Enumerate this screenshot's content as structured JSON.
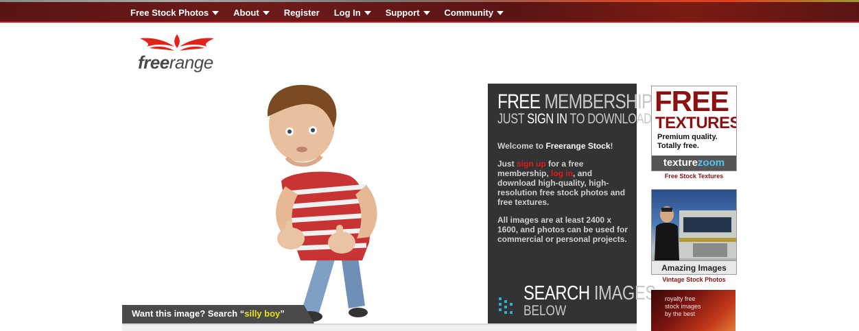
{
  "nav": {
    "items": [
      {
        "label": "Free Stock Photos",
        "dropdown": true
      },
      {
        "label": "About",
        "dropdown": true
      },
      {
        "label": "Register",
        "dropdown": false
      },
      {
        "label": "Log In",
        "dropdown": true
      },
      {
        "label": "Support",
        "dropdown": true
      },
      {
        "label": "Community",
        "dropdown": true
      }
    ]
  },
  "logo": {
    "free": "free",
    "range": "range"
  },
  "hero": {
    "caption_prefix": "Want this image?  Search “",
    "caption_term": "silly boy",
    "caption_suffix": "”"
  },
  "member": {
    "title_a": "FREE",
    "title_b": "MEMBERSHIP",
    "sub_a": "JUST",
    "sub_b": "SIGN IN",
    "sub_c": "TO DOWNLOAD",
    "welcome_prefix": "Welcome to ",
    "welcome_brand": "Freerange Stock",
    "welcome_suffix": "!",
    "just": "Just ",
    "signup": "sign up",
    "mid": " for a free membership, ",
    "login": "log in",
    "rest": ", and download high-quality, high-resolution free stock photos and free textures.",
    "images_note": "All images are at least 2400 x 1600, and photos can be used for commercial or personal projects.",
    "search_a": "SEARCH",
    "search_b": "IMAGES",
    "search_c": "BELOW"
  },
  "ads": {
    "textures": {
      "free": "FREE",
      "textures": "TEXTURES",
      "line1": "Premium quality.",
      "line2": "Totally free.",
      "brand_a": "texture",
      "brand_b": "zoom",
      "caption": "Free Stock Textures"
    },
    "vintage": {
      "label": "Amazing Images",
      "caption": "Vintage Stock Photos"
    },
    "royalty": {
      "line1": "royalty free",
      "line2": "stock images",
      "line3": "by the best"
    }
  },
  "colors": {
    "nav_bg": "#5a1414",
    "accent_red": "#c4161c",
    "panel_bg": "#333333",
    "caption_term": "#e8e21a"
  }
}
